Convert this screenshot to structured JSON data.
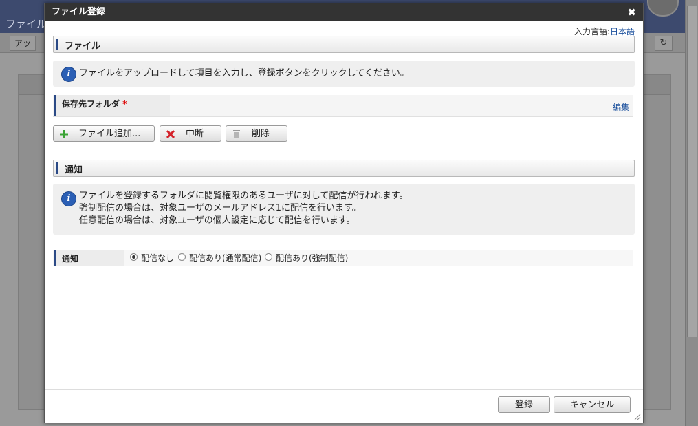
{
  "background": {
    "app_title": "ファイル",
    "toolbar_button": "アッ",
    "refresh_icon": "refresh-icon"
  },
  "dialog": {
    "title": "ファイル登録",
    "close_icon": "close-icon",
    "input_language_label": "入力言語:",
    "input_language_value": "日本語",
    "file_section": {
      "heading": "ファイル",
      "info": "ファイルをアップロードして項目を入力し、登録ボタンをクリックしてください。",
      "folder_label": "保存先フォルダ",
      "required_mark": "*",
      "edit_link": "編集",
      "buttons": {
        "add": "ファイル追加...",
        "stop": "中断",
        "delete": "削除"
      }
    },
    "notify_section": {
      "heading": "通知",
      "info_lines": [
        "ファイルを登録するフォルダに閲覧権限のあるユーザに対して配信が行われます。",
        "強制配信の場合は、対象ユーザのメールアドレス1に配信を行います。",
        "任意配信の場合は、対象ユーザの個人設定に応じて配信を行います。"
      ],
      "field_label": "通知",
      "options": [
        "配信なし",
        "配信あり(通常配信)",
        "配信あり(強制配信)"
      ],
      "selected_index": 0
    },
    "footer": {
      "register": "登録",
      "cancel": "キャンセル"
    }
  },
  "colors": {
    "title_bar": "#333333",
    "accent_bar": "#2b4a86",
    "link": "#1a4f9c",
    "info_icon": "#2b5fb5",
    "add_icon": "#3aa335",
    "stop_icon": "#d4222a"
  }
}
